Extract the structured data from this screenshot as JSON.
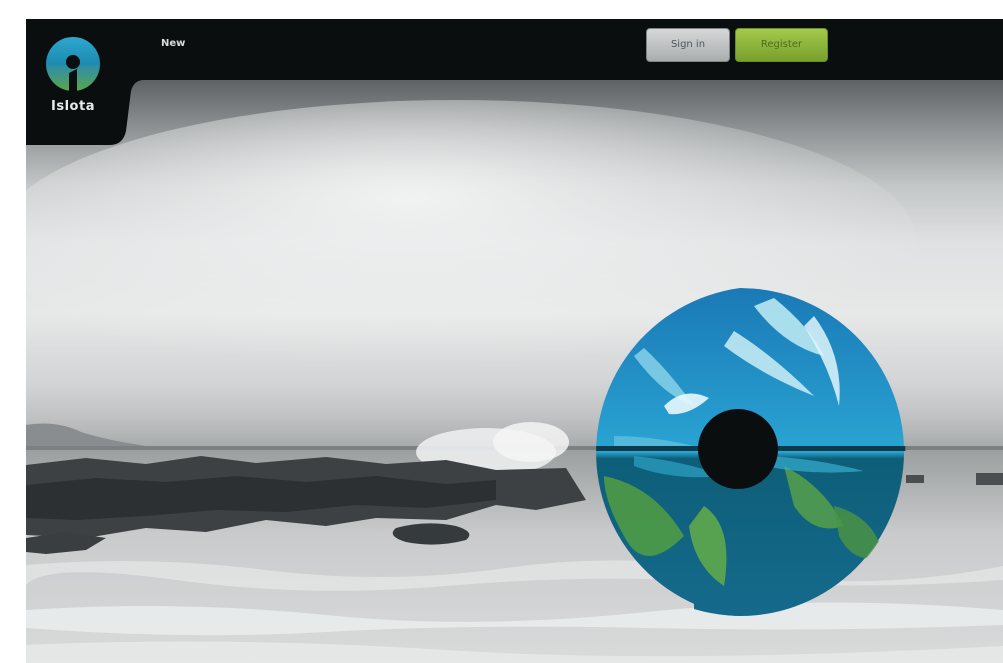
{
  "brand": {
    "name": "Islota",
    "logo_icon": "islota-logo-icon"
  },
  "nav": {
    "links": [
      {
        "label": "New"
      }
    ]
  },
  "auth": {
    "signin_label": "Sign in",
    "register_label": "Register"
  },
  "hero": {
    "image": "grayscale-ocean-waves-photo",
    "emblem_icon": "aurora-emblem-icon"
  },
  "colors": {
    "navbar": "#0b0e0f",
    "signin_button": "#b8bbbc",
    "register_button": "#8cb63a",
    "emblem_teal": "#1f8fb8",
    "emblem_green": "#4c9a45"
  }
}
